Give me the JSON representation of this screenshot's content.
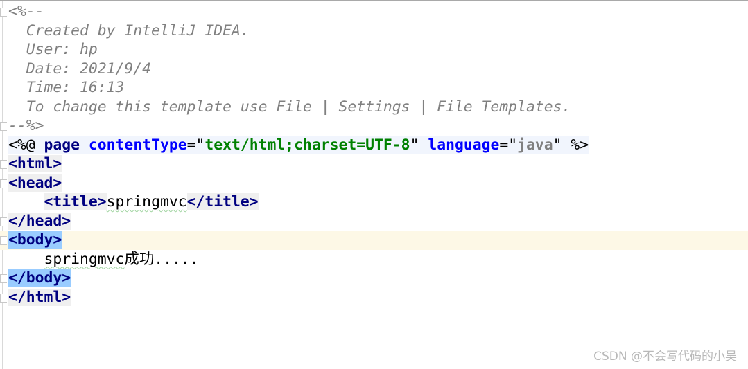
{
  "editor": {
    "current_line": 12,
    "lines": [
      {
        "fold": true,
        "tokens": [
          {
            "text": "<%--",
            "cls": "c"
          }
        ]
      },
      {
        "tokens": [
          {
            "text": "  Created by IntelliJ IDEA.",
            "cls": "c"
          }
        ]
      },
      {
        "tokens": [
          {
            "text": "  User: hp",
            "cls": "c"
          }
        ]
      },
      {
        "tokens": [
          {
            "text": "  Date: 2021/9/4",
            "cls": "c"
          }
        ]
      },
      {
        "tokens": [
          {
            "text": "  Time: 16:13",
            "cls": "c"
          }
        ]
      },
      {
        "tokens": [
          {
            "text": "  To change this template use File | Settings | File Templates.",
            "cls": "c"
          }
        ]
      },
      {
        "fold": true,
        "tokens": [
          {
            "text": "--%>",
            "cls": "c"
          }
        ]
      },
      {
        "tokens": [
          {
            "text": "<%@ ",
            "cls": "d p"
          },
          {
            "text": "page",
            "cls": "d dn"
          },
          {
            "text": " ",
            "cls": "d"
          },
          {
            "text": "contentType",
            "cls": "d an"
          },
          {
            "text": "=\"",
            "cls": "d p"
          },
          {
            "text": "text/html;charset=UTF-8",
            "cls": "d av"
          },
          {
            "text": "\" ",
            "cls": "d p"
          },
          {
            "text": "language",
            "cls": "d an"
          },
          {
            "text": "=\"",
            "cls": "d p"
          },
          {
            "text": "java",
            "cls": "d ag"
          },
          {
            "text": "\" %>",
            "cls": "d p"
          }
        ]
      },
      {
        "fold": true,
        "tokens": [
          {
            "text": "<html>",
            "cls": "t"
          }
        ]
      },
      {
        "fold": true,
        "tokens": [
          {
            "text": "<head>",
            "cls": "t"
          }
        ]
      },
      {
        "tokens": [
          {
            "text": "    ",
            "cls": "p"
          },
          {
            "text": "<title>",
            "cls": "t"
          },
          {
            "text": "springmvc",
            "cls": "sq"
          },
          {
            "text": "</title>",
            "cls": "t"
          }
        ]
      },
      {
        "fold": true,
        "tokens": [
          {
            "text": "</head>",
            "cls": "t"
          }
        ]
      },
      {
        "fold": true,
        "tokens": [
          {
            "text": "<body>",
            "cls": "tb"
          }
        ]
      },
      {
        "tokens": [
          {
            "text": "    ",
            "cls": "p"
          },
          {
            "text": "springmvc",
            "cls": "sq"
          },
          {
            "text": "成功.....",
            "cls": "p"
          }
        ]
      },
      {
        "fold": true,
        "tokens": [
          {
            "text": "</body>",
            "cls": "tb"
          }
        ]
      },
      {
        "fold": true,
        "tokens": [
          {
            "text": "</html>",
            "cls": "t"
          }
        ]
      }
    ]
  },
  "watermark": "CSDN @不会写代码的小吴"
}
